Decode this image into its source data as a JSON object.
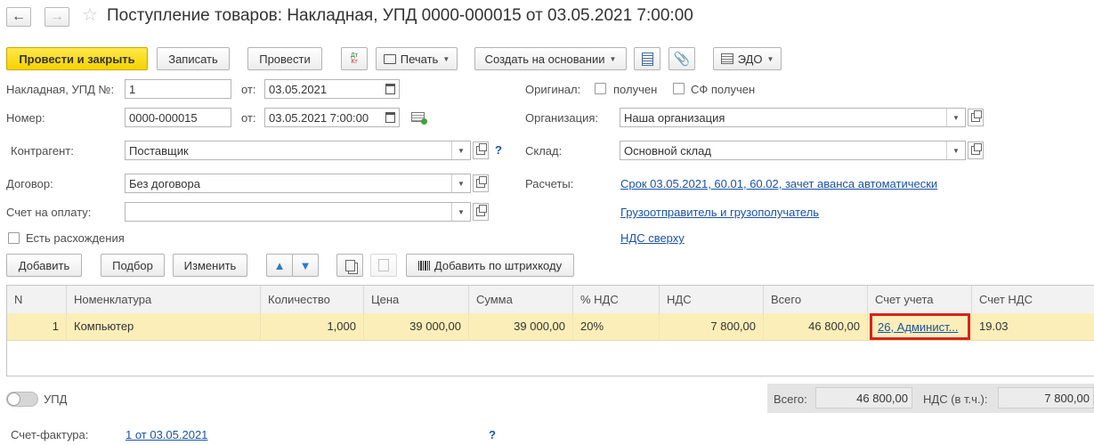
{
  "window": {
    "title": "Поступление товаров: Накладная, УПД 0000-000015 от 03.05.2021 7:00:00"
  },
  "toolbar": {
    "post_close": "Провести и закрыть",
    "save": "Записать",
    "post": "Провести",
    "dt_kt": "Дт Кт",
    "print": "Печать",
    "create_based": "Создать на основании",
    "edo": "ЭДО"
  },
  "header": {
    "invoice_label": "Накладная, УПД №:",
    "invoice_value": "1",
    "from_label": "от:",
    "invoice_date": "03.05.2021",
    "number_label": "Номер:",
    "number_value": "0000-000015",
    "from_label2": "от:",
    "number_date": "03.05.2021  7:00:00",
    "original_label": "Оригинал:",
    "received_label": "получен",
    "sf_received_label": "СФ получен",
    "org_label": "Организация:",
    "org_value": "Наша организация",
    "contractor_label": "Контрагент:",
    "contractor_value": "Поставщик",
    "warehouse_label": "Склад:",
    "warehouse_value": "Основной склад",
    "contract_label": "Договор:",
    "contract_value": "Без договора",
    "settlements_label": "Расчеты:",
    "settlements_link": "Срок 03.05.2021, 60.01, 60.02, зачет аванса автоматически",
    "payment_label": "Счет на оплату:",
    "payment_value": "",
    "shipper_link": "Грузоотправитель и грузополучатель",
    "vat_link": "НДС сверху",
    "discrepancy_label": "Есть расхождения"
  },
  "table_toolbar": {
    "add": "Добавить",
    "pick": "Подбор",
    "change": "Изменить",
    "barcode": "Добавить по штрихкоду"
  },
  "table": {
    "columns": [
      "N",
      "Номенклатура",
      "Количество",
      "Цена",
      "Сумма",
      "% НДС",
      "НДС",
      "Всего",
      "Счет учета",
      "Счет НДС"
    ],
    "rows": [
      [
        "1",
        "Компьютер",
        "1,000",
        "39 000,00",
        "39 000,00",
        "20%",
        "7 800,00",
        "46 800,00",
        "26, Админист...",
        "19.03"
      ]
    ]
  },
  "footer": {
    "upd_label": "УПД",
    "total_label": "Всего:",
    "total_value": "46 800,00",
    "vat_label": "НДС (в т.ч.):",
    "vat_value": "7 800,00",
    "invoice_label": "Счет-фактура:",
    "invoice_link": "1 от 03.05.2021",
    "help": "?"
  },
  "colors": {
    "primary_button": "#f5d200",
    "link": "#1a52a8",
    "selected_row": "#fbeeb8",
    "highlight_border": "#d9231d"
  }
}
